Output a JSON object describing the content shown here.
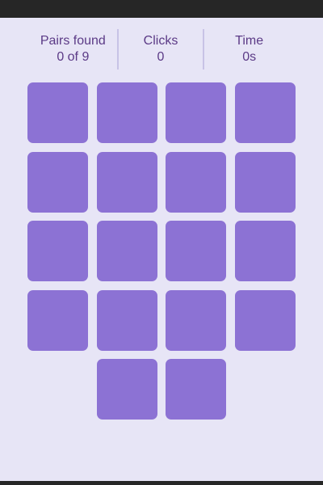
{
  "stats": {
    "pairs": {
      "label": "Pairs found",
      "value": "0 of 9"
    },
    "clicks": {
      "label": "Clicks",
      "value": "0"
    },
    "time": {
      "label": "Time",
      "value": "0s"
    }
  },
  "board": {
    "card_count": 18,
    "face_down_color": "#8c72d4",
    "background_color": "#e7e5f6",
    "text_color": "#5b3a86"
  }
}
